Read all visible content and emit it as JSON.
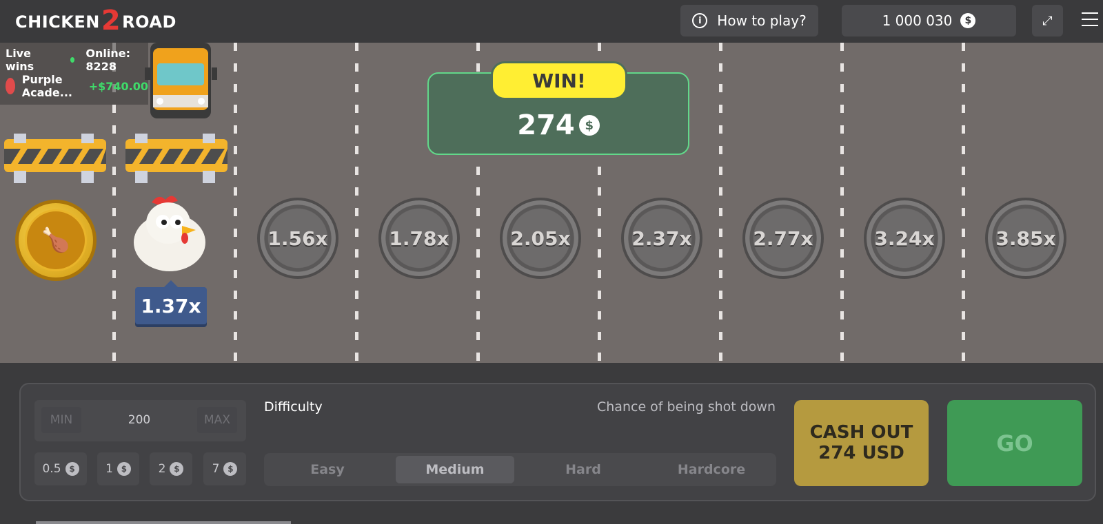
{
  "header": {
    "logo_part1": "CHICKEN",
    "logo_part2": "2",
    "logo_part3": "ROAD",
    "how_to_play": "How to play?",
    "balance": "1 000 030",
    "currency_symbol": "$"
  },
  "live": {
    "label": "Live wins",
    "online": "Online: 8228",
    "winner_name": "Purple Acade...",
    "winner_amount": "+$740.00"
  },
  "game": {
    "current_multiplier": "1.37x",
    "multipliers": [
      "1.56x",
      "1.78x",
      "2.05x",
      "2.37x",
      "2.77x",
      "3.24x",
      "3.85x"
    ],
    "win_label": "WIN!",
    "win_amount": "274",
    "win_currency": "$"
  },
  "controls": {
    "min": "MIN",
    "max": "MAX",
    "bet_value": "200",
    "chips": [
      "0.5",
      "1",
      "2",
      "7"
    ],
    "difficulty_label": "Difficulty",
    "chance_label": "Chance of being shot down",
    "difficulties": [
      "Easy",
      "Medium",
      "Hard",
      "Hardcore"
    ],
    "active_difficulty": "Medium",
    "cashout_line1": "CASH OUT",
    "cashout_line2": "274 USD",
    "go": "GO"
  },
  "colors": {
    "road": "#716b69",
    "win_green": "#4e6e5a",
    "win_yellow": "#ffee33",
    "cashout": "#b59a3f",
    "go": "#3f9a55",
    "multiplier_badge": "#3f5a8c"
  }
}
